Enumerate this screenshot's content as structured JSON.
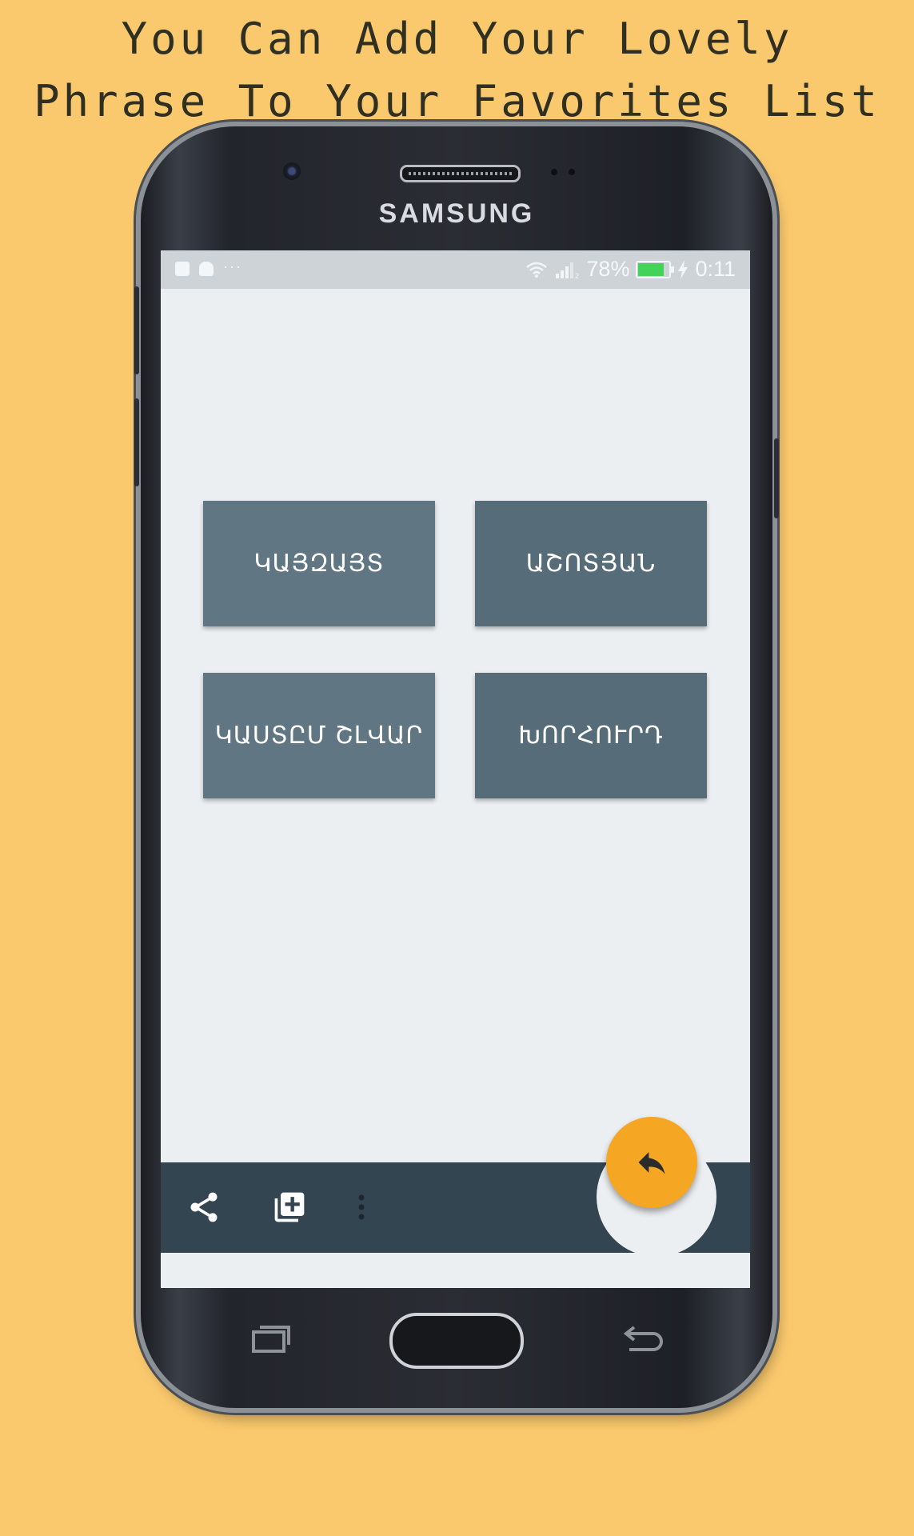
{
  "promo": {
    "line1": "You Can Add Your Lovely",
    "line2": "Phrase To Your Favorites List"
  },
  "device": {
    "brand": "SAMSUNG"
  },
  "status_bar": {
    "battery_percent": "78%",
    "battery_level": 0.78,
    "time": "0:11",
    "signal_sim": "2"
  },
  "tiles": [
    {
      "label": "ԿԱՅԶԱՅՏ"
    },
    {
      "label": "ԱՇՈՏՅԱՆ"
    },
    {
      "label": "ԿԱՍՏԸՄ ՇԼՎԱՐ"
    },
    {
      "label": "ԽՈՐՀՈՒՐԴ"
    }
  ],
  "bottom_bar": {
    "icons": [
      "share-icon",
      "add-to-library-icon",
      "more-vert-icon"
    ]
  },
  "fab": {
    "icon": "reply-icon",
    "color": "#f5a623"
  },
  "nav": {
    "icons": [
      "recent-apps-icon",
      "home-button",
      "back-icon"
    ]
  },
  "colors": {
    "background": "#fbc96d",
    "tile_left": "#617683",
    "tile_right": "#566d79",
    "bottom_bar": "#344552"
  }
}
